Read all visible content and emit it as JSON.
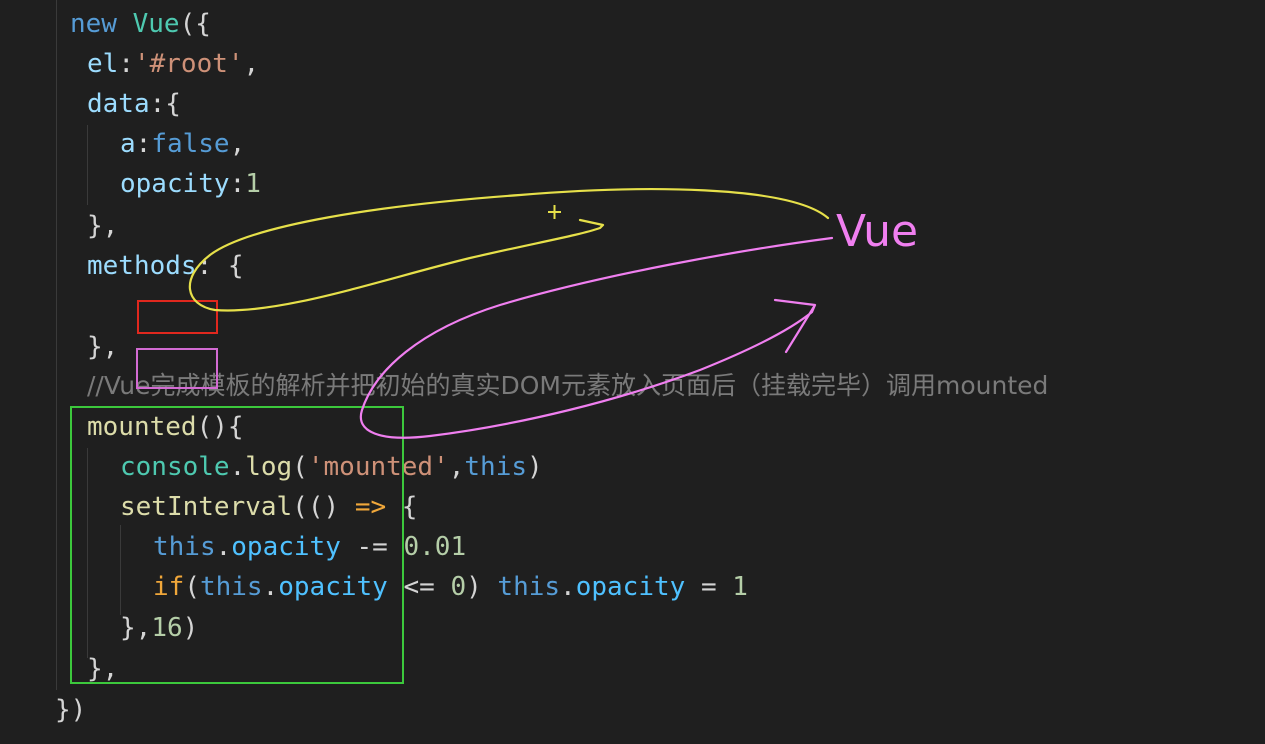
{
  "code": {
    "l1": {
      "kw": "new",
      "cls": "Vue",
      "punc": "({"
    },
    "l2": {
      "prop": "el",
      "colon": ":",
      "str": "'#root'",
      "punc": ","
    },
    "l3": {
      "prop": "data",
      "punc": ":{"
    },
    "l4": {
      "prop": "a",
      "colon": ":",
      "val": "false",
      "punc": ","
    },
    "l5": {
      "prop": "opacity",
      "colon": ":",
      "num": "1"
    },
    "l6": {
      "punc": "},"
    },
    "l7": {
      "prop": "methods",
      "punc": ": {"
    },
    "l8": {
      "punc": "},"
    },
    "l9": {
      "comment": "//Vue完成模板的解析并把初始的真实DOM元素放入页面后（挂载完毕）调用mounted"
    },
    "l10": {
      "fn": "mounted",
      "punc": "(){"
    },
    "l11": {
      "obj": "console",
      "dot": ".",
      "fn": "log",
      "open": "(",
      "str": "'mounted'",
      "comma": ",",
      "this": "this",
      "close": ")"
    },
    "l12": {
      "fn": "setInterval",
      "open": "((",
      "close": ")",
      "arrow": "=>",
      "brace": "{"
    },
    "l13": {
      "this": "this",
      "dot": ".",
      "prop": "opacity",
      "op": "-=",
      "num": "0.01"
    },
    "l14": {
      "ctl": "if",
      "open": "(",
      "this": "this",
      "dot": ".",
      "prop": "opacity",
      "op": "<=",
      "num": "0",
      "close": ")",
      "this2": "this",
      "dot2": ".",
      "prop2": "opacity",
      "op2": "=",
      "num2": "1"
    },
    "l15": {
      "punc": "},",
      "num": "16",
      "close": ")"
    },
    "l16": {
      "punc": "},"
    },
    "l17": {
      "punc": "})"
    }
  },
  "annotation": {
    "label": "Vue",
    "plus": "+"
  },
  "colors": {
    "background": "#1f1f1f",
    "yellow_stroke": "#e6e04a",
    "pink_stroke": "#f07ff0",
    "red_box": "#e0281e",
    "green_box": "#3cc83c"
  }
}
